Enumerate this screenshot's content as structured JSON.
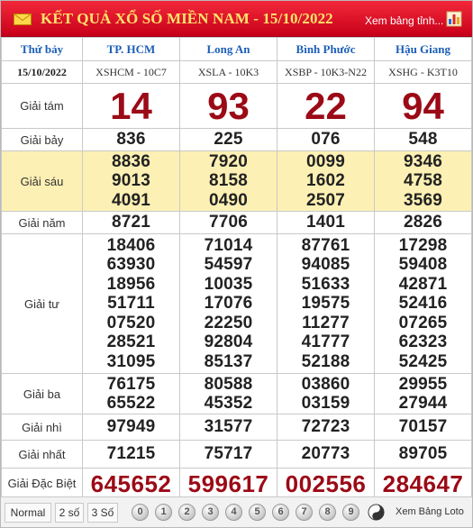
{
  "header": {
    "title": "KẾT QUẢ XỔ SỐ MIỀN NAM - 15/10/2022",
    "link": "Xem bảng tỉnh...",
    "mail_icon": "envelope-icon",
    "chart_icon": "bar-chart-icon"
  },
  "table": {
    "day": "Thứ bảy",
    "date": "15/10/2022",
    "provinces": [
      {
        "name": "TP. HCM",
        "code": "XSHCM - 10C7"
      },
      {
        "name": "Long An",
        "code": "XSLA - 10K3"
      },
      {
        "name": "Bình Phước",
        "code": "XSBP - 10K3-N22"
      },
      {
        "name": "Hậu Giang",
        "code": "XSHG - K3T10"
      }
    ],
    "prizes": [
      {
        "label": "Giải tám",
        "values": [
          [
            "14"
          ],
          [
            "93"
          ],
          [
            "22"
          ],
          [
            "94"
          ]
        ]
      },
      {
        "label": "Giải bảy",
        "values": [
          [
            "836"
          ],
          [
            "225"
          ],
          [
            "076"
          ],
          [
            "548"
          ]
        ]
      },
      {
        "label": "Giải sáu",
        "values": [
          [
            "8836",
            "9013",
            "4091"
          ],
          [
            "7920",
            "8158",
            "0490"
          ],
          [
            "0099",
            "1602",
            "2507"
          ],
          [
            "9346",
            "4758",
            "3569"
          ]
        ]
      },
      {
        "label": "Giải năm",
        "values": [
          [
            "8721"
          ],
          [
            "7706"
          ],
          [
            "1401"
          ],
          [
            "2826"
          ]
        ]
      },
      {
        "label": "Giải tư",
        "values": [
          [
            "18406",
            "63930",
            "18956",
            "51711",
            "07520",
            "28521",
            "31095"
          ],
          [
            "71014",
            "54597",
            "10035",
            "17076",
            "22250",
            "92804",
            "85137"
          ],
          [
            "87761",
            "94085",
            "51633",
            "19575",
            "11277",
            "41777",
            "52188"
          ],
          [
            "17298",
            "59408",
            "42871",
            "52416",
            "07265",
            "62323",
            "52425"
          ]
        ]
      },
      {
        "label": "Giải ba",
        "values": [
          [
            "76175",
            "65522"
          ],
          [
            "80588",
            "45352"
          ],
          [
            "03860",
            "03159"
          ],
          [
            "29955",
            "27944"
          ]
        ]
      },
      {
        "label": "Giải nhì",
        "values": [
          [
            "97949"
          ],
          [
            "31577"
          ],
          [
            "72723"
          ],
          [
            "70157"
          ]
        ]
      },
      {
        "label": "Giải nhất",
        "values": [
          [
            "71215"
          ],
          [
            "75717"
          ],
          [
            "20773"
          ],
          [
            "89705"
          ]
        ]
      },
      {
        "label": "Giải Đặc Biệt",
        "values": [
          [
            "645652"
          ],
          [
            "599617"
          ],
          [
            "002556"
          ],
          [
            "284647"
          ]
        ]
      }
    ]
  },
  "footer": {
    "tabs": [
      "Normal",
      "2 số",
      "3 Số"
    ],
    "digits": [
      "0",
      "1",
      "2",
      "3",
      "4",
      "5",
      "6",
      "7",
      "8",
      "9"
    ],
    "yinyang_icon": "yin-yang-icon",
    "link": "Xem Bảng Loto"
  }
}
